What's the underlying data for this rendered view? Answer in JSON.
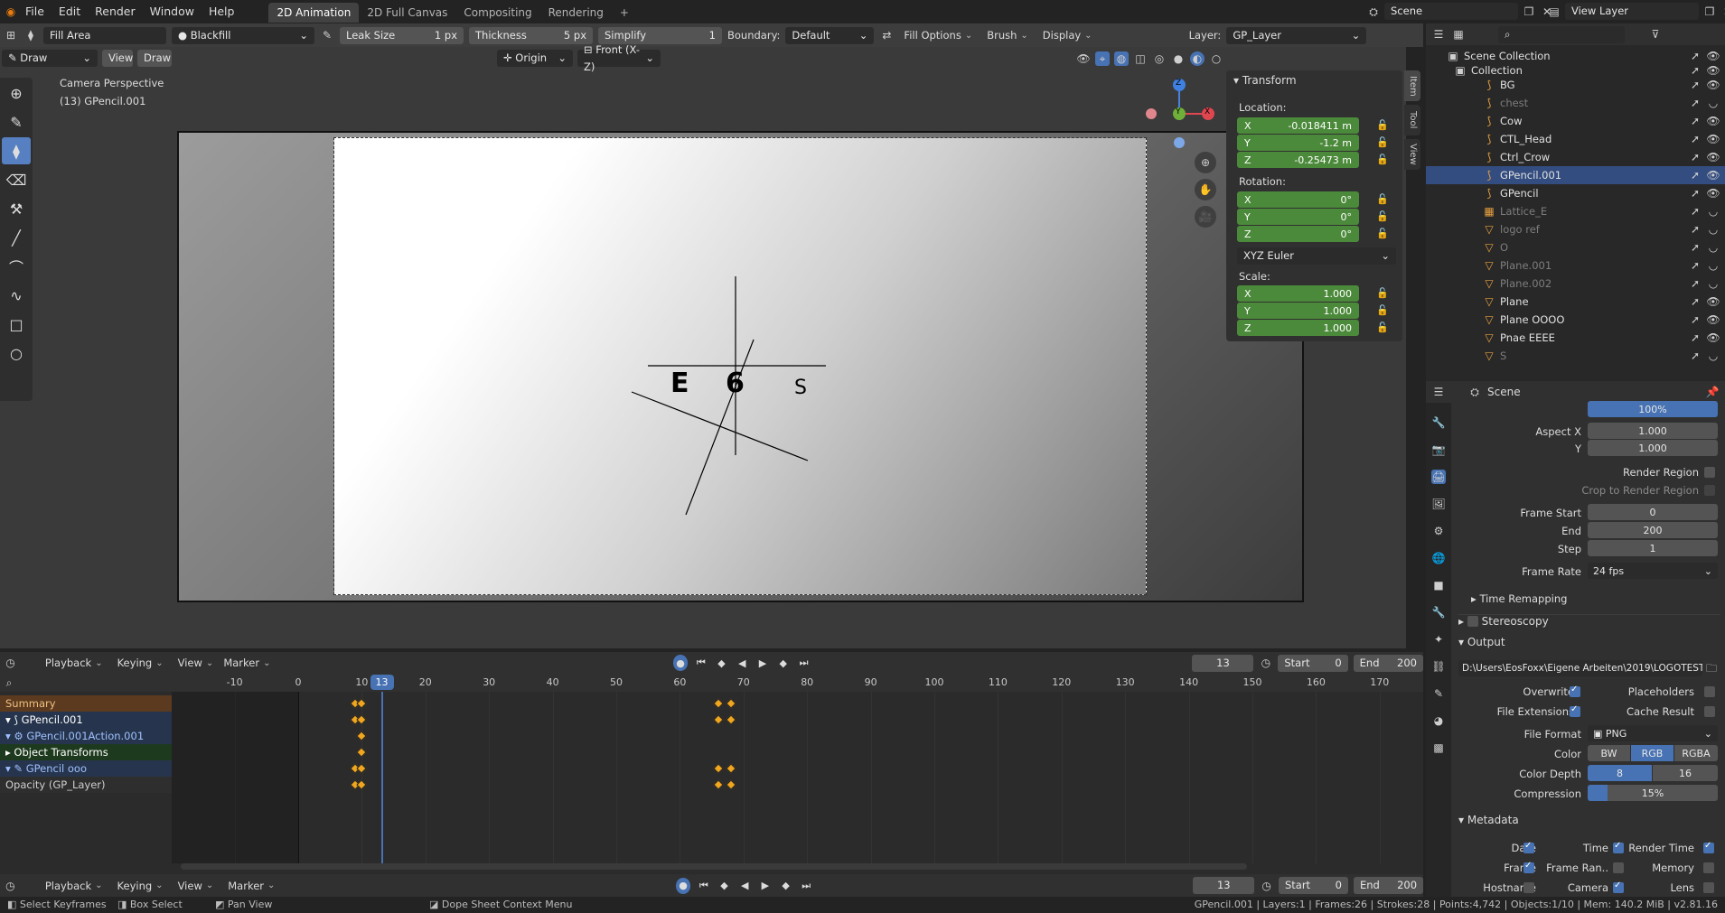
{
  "topbar": {
    "menus": [
      "File",
      "Edit",
      "Render",
      "Window",
      "Help"
    ],
    "workspaces": [
      "2D Animation",
      "2D Full Canvas",
      "Compositing",
      "Rendering"
    ],
    "active_workspace": "2D Animation",
    "add_tab": "+",
    "scene_label": "Scene",
    "view_layer_label": "View Layer"
  },
  "toolheader": {
    "fill_area": "Fill Area",
    "material": "Blackfill",
    "leak_size_label": "Leak Size",
    "leak_size_value": "1 px",
    "thickness_label": "Thickness",
    "thickness_value": "5 px",
    "simplify_label": "Simplify",
    "simplify_value": "1",
    "boundary_label": "Boundary:",
    "boundary_value": "Default",
    "fill_options": "Fill Options",
    "brush": "Brush",
    "display": "Display",
    "layer_label": "Layer:",
    "layer_value": "GP_Layer"
  },
  "viewport_header": {
    "mode": "Draw",
    "view": "View",
    "draw": "Draw",
    "origin": "Origin",
    "orientation": "Front (X-Z)"
  },
  "viewport": {
    "camera_label": "Camera Perspective",
    "object_label": "(13) GPencil.001",
    "canvas_letters": [
      "E",
      "6",
      "S"
    ],
    "gizmo": {
      "z": "Z",
      "y": "Y",
      "x": "X"
    }
  },
  "npanel": {
    "title": "Transform",
    "location_label": "Location:",
    "location": {
      "X": "-0.018411 m",
      "Y": "-1.2 m",
      "Z": "-0.25473 m"
    },
    "rotation_label": "Rotation:",
    "rotation": {
      "X": "0°",
      "Y": "0°",
      "Z": "0°"
    },
    "rotation_mode": "XYZ Euler",
    "scale_label": "Scale:",
    "scale": {
      "X": "1.000",
      "Y": "1.000",
      "Z": "1.000"
    },
    "tabs": [
      "Item",
      "Tool",
      "View"
    ]
  },
  "outliner": {
    "root": "Scene Collection",
    "collection": "Collection",
    "items": [
      {
        "name": "BG",
        "dim": false
      },
      {
        "name": "chest",
        "dim": true
      },
      {
        "name": "Cow",
        "dim": false
      },
      {
        "name": "CTL_Head",
        "dim": false
      },
      {
        "name": "Ctrl_Crow",
        "dim": false
      },
      {
        "name": "GPencil.001",
        "dim": false,
        "selected": true
      },
      {
        "name": "GPencil",
        "dim": false
      },
      {
        "name": "Lattice_E",
        "dim": true
      },
      {
        "name": "logo ref",
        "dim": true
      },
      {
        "name": "O",
        "dim": true
      },
      {
        "name": "Plane.001",
        "dim": true
      },
      {
        "name": "Plane.002",
        "dim": true
      },
      {
        "name": "Plane",
        "dim": false
      },
      {
        "name": "Plane OOOO",
        "dim": false
      },
      {
        "name": "Pnae EEEE",
        "dim": false
      },
      {
        "name": "S",
        "dim": true
      }
    ]
  },
  "properties": {
    "context": "Scene",
    "resolution_pct": "100%",
    "aspect_x_label": "Aspect X",
    "aspect_x": "1.000",
    "aspect_y_label": "Y",
    "aspect_y": "1.000",
    "render_region": "Render Region",
    "crop_region": "Crop to Render Region",
    "frame_start_label": "Frame Start",
    "frame_start": "0",
    "end_label": "End",
    "end": "200",
    "step_label": "Step",
    "step": "1",
    "frame_rate_label": "Frame Rate",
    "frame_rate": "24 fps",
    "time_remapping": "Time Remapping",
    "stereoscopy": "Stereoscopy",
    "output": "Output",
    "output_path": "D:\\Users\\EosFoxx\\Eigene Arbeiten\\2019\\LOGOTEST",
    "overwrite": "Overwrite",
    "placeholders": "Placeholders",
    "file_extensions": "File Extensions",
    "cache_result": "Cache Result",
    "file_format_label": "File Format",
    "file_format": "PNG",
    "color_label": "Color",
    "color_options": [
      "BW",
      "RGB",
      "RGBA"
    ],
    "color_active": "RGB",
    "color_depth_label": "Color Depth",
    "color_depth": [
      "8",
      "16"
    ],
    "compression_label": "Compression",
    "compression": "15%",
    "compression_fraction": 0.15,
    "metadata": "Metadata",
    "meta": {
      "date": "Date",
      "time": "Time",
      "render_time": "Render Time",
      "frame": "Frame",
      "frame_range": "Frame Ran..",
      "memory": "Memory",
      "hostname": "Hostname",
      "camera": "Camera",
      "lens": "Lens"
    }
  },
  "dopesheet": {
    "playback": "Playback",
    "keying": "Keying",
    "view": "View",
    "marker": "Marker",
    "current_frame": "13",
    "start_label": "Start",
    "start": "0",
    "end_label": "End",
    "end": "200",
    "ruler": [
      "-10",
      "0",
      "10",
      "13",
      "20",
      "30",
      "40",
      "50",
      "60",
      "70",
      "80",
      "90",
      "100",
      "110",
      "120",
      "130",
      "140",
      "150",
      "160",
      "170"
    ],
    "channels": [
      {
        "name": "Summary",
        "kind": "summary"
      },
      {
        "name": "GPencil.001",
        "kind": "object"
      },
      {
        "name": "GPencil.001Action.001",
        "kind": "action"
      },
      {
        "name": "Object Transforms",
        "kind": "group"
      },
      {
        "name": "GPencil ooo",
        "kind": "gp"
      },
      {
        "name": "Opacity (GP_Layer)",
        "kind": "layer"
      }
    ]
  },
  "statusbar": {
    "select": "Select Keyframes",
    "box": "Box Select",
    "pan": "Pan View",
    "context": "Dope Sheet Context Menu",
    "stats": "GPencil.001 | Layers:1 | Frames:26 | Strokes:28 | Points:4,742 | Objects:1/10 | Mem: 140.2 MiB | v2.81.16"
  }
}
